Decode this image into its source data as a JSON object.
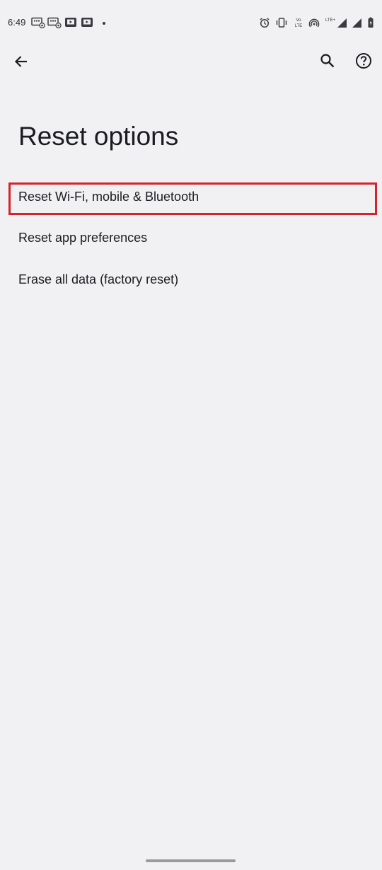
{
  "status_bar": {
    "time": "6:49",
    "volte_top": "Vo",
    "volte_bottom": "LTE",
    "lte_label": "LTE+",
    "left_icons": [
      "screen-record-icon",
      "screen-record-icon",
      "youtube-icon",
      "youtube-icon"
    ],
    "right_icons": [
      "alarm-icon",
      "vibrate-icon",
      "volte-icon",
      "hotspot-icon",
      "signal-icon",
      "signal-icon",
      "battery-icon"
    ]
  },
  "toolbar": {
    "back_icon": "arrow-left-icon",
    "search_icon": "search-icon",
    "help_icon": "help-circle-icon"
  },
  "page": {
    "title": "Reset options"
  },
  "options": [
    {
      "label": "Reset Wi-Fi, mobile & Bluetooth",
      "highlighted": true
    },
    {
      "label": "Reset app preferences",
      "highlighted": false
    },
    {
      "label": "Erase all data (factory reset)",
      "highlighted": false
    }
  ],
  "colors": {
    "background": "#f1f1f3",
    "text": "#1b1c1f",
    "highlight": "#d6222a"
  }
}
